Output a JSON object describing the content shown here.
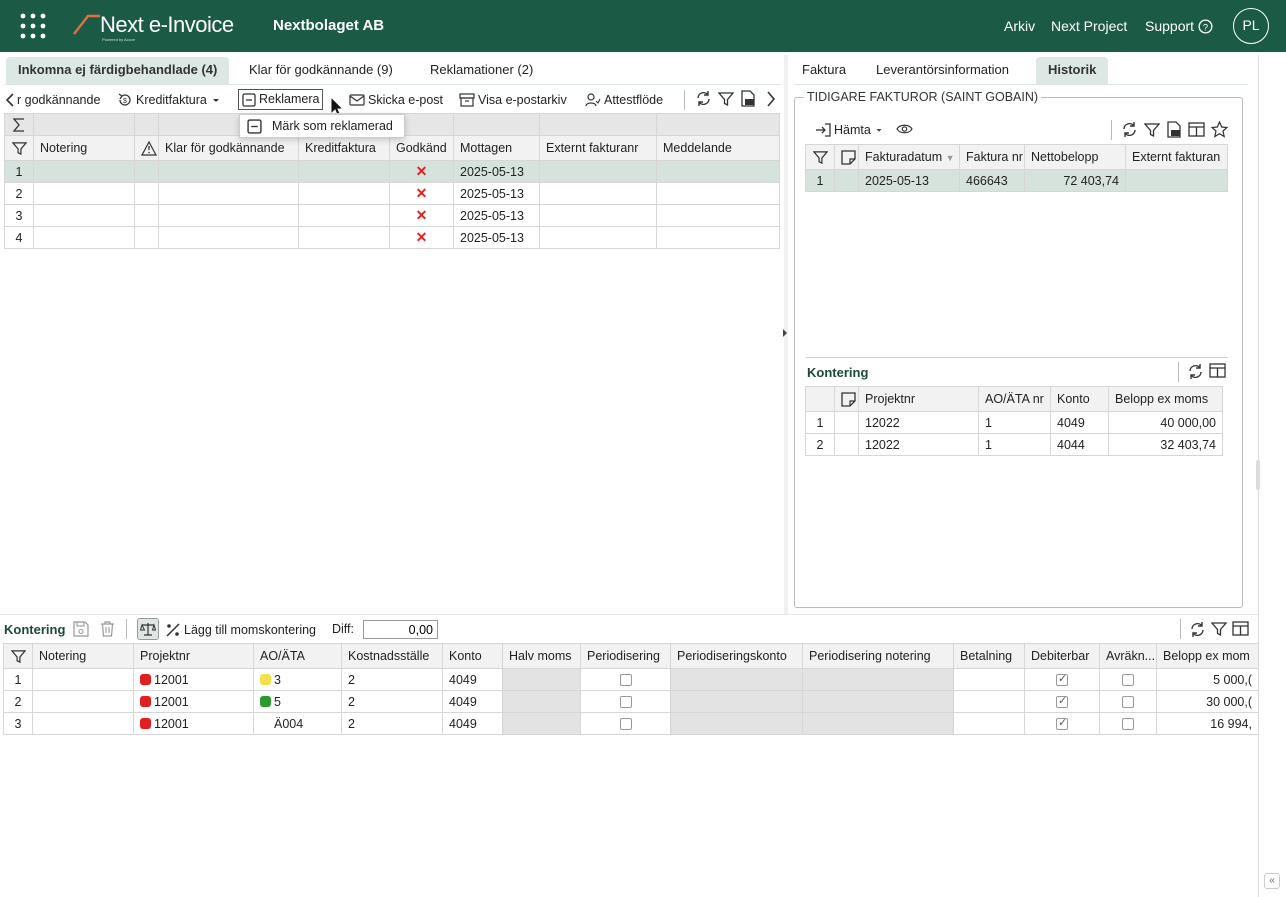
{
  "header": {
    "logo_text": "Next e-Invoice",
    "logo_sub": "Powered by Acove",
    "company": "Nextbolaget AB",
    "links": [
      "Arkiv",
      "Next Project",
      "Support"
    ],
    "avatar": "PL"
  },
  "left_tabs": [
    "Inkomna ej färdigbehandlade (4)",
    "Klar för godkännande (9)",
    "Reklamationer (2)"
  ],
  "right_tabs": [
    "Faktura",
    "Leverantörsinformation",
    "Historik"
  ],
  "toolbar": {
    "godkannande": "r godkännande",
    "kreditfaktura": "Kreditfaktura",
    "reklamera": "Reklamera",
    "skicka_epost": "Skicka e-post",
    "visa_epostarkiv": "Visa e-postarkiv",
    "attestflode": "Attestflöde"
  },
  "popup": {
    "item": "Märk som reklamerad"
  },
  "invoice_grid": {
    "columns": [
      "Notering",
      "Klar för godkännande",
      "Kreditfaktura",
      "Godkänd",
      "Mottagen",
      "Externt fakturanr",
      "Meddelande"
    ],
    "rows": [
      {
        "n": "1",
        "mottagen": "2025-05-13"
      },
      {
        "n": "2",
        "mottagen": "2025-05-13"
      },
      {
        "n": "3",
        "mottagen": "2025-05-13"
      },
      {
        "n": "4",
        "mottagen": "2025-05-13"
      }
    ]
  },
  "history": {
    "legend": "TIDIGARE FAKTUROR (SAINT GOBAIN)",
    "hamta": "Hämta",
    "columns": [
      "Fakturadatum",
      "Faktura nr",
      "Nettobelopp",
      "Externt fakturan"
    ],
    "rows": [
      {
        "n": "1",
        "datum": "2025-05-13",
        "nr": "466643",
        "netto": "72 403,74",
        "ext": ""
      }
    ]
  },
  "history_kontering": {
    "title": "Kontering",
    "columns": [
      "Projektnr",
      "AO/ÄTA nr",
      "Konto",
      "Belopp ex moms"
    ],
    "rows": [
      {
        "n": "1",
        "projekt": "12022",
        "ao": "1",
        "konto": "4049",
        "belopp": "40 000,00"
      },
      {
        "n": "2",
        "projekt": "12022",
        "ao": "1",
        "konto": "4044",
        "belopp": "32 403,74"
      }
    ]
  },
  "kontering": {
    "title": "Kontering",
    "lagg_till": "Lägg till momskontering",
    "diff_label": "Diff:",
    "diff_value": "0,00",
    "columns": [
      "Notering",
      "Projektnr",
      "AO/ÄTA",
      "Kostnadsställe",
      "Konto",
      "Halv moms",
      "Periodisering",
      "Periodiseringskonto",
      "Periodisering notering",
      "Betalning",
      "Debiterbar",
      "Avräkn...",
      "Belopp ex mom"
    ],
    "rows": [
      {
        "n": "1",
        "projekt": "12001",
        "projekt_color": "#e02020",
        "ao": "3",
        "ao_color": "#f2e14a",
        "kst": "2",
        "konto": "4049",
        "debiterbar": true,
        "avrakn": false,
        "belopp": "5 000,("
      },
      {
        "n": "2",
        "projekt": "12001",
        "projekt_color": "#e02020",
        "ao": "5",
        "ao_color": "#2e9a2e",
        "kst": "2",
        "konto": "4049",
        "debiterbar": true,
        "avrakn": false,
        "belopp": "30 000,("
      },
      {
        "n": "3",
        "projekt": "12001",
        "projekt_color": "#e02020",
        "ao": "Ä004",
        "ao_color": "",
        "kst": "2",
        "konto": "4049",
        "debiterbar": true,
        "avrakn": false,
        "belopp": "16 994,"
      }
    ]
  }
}
